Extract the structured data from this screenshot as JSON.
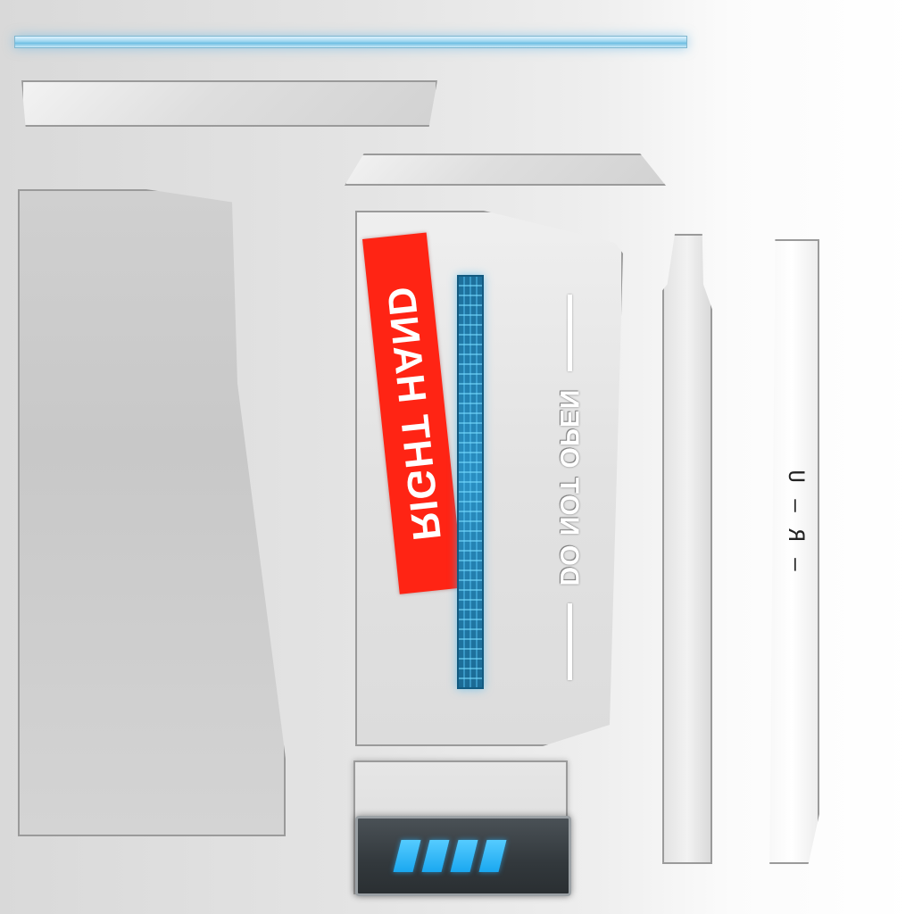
{
  "labels": {
    "right_hand": "RIGHT HAND",
    "warning": "DO NOT OPEN",
    "code": "— R — U"
  },
  "colors": {
    "label_red": "#ff2414",
    "accent_blue": "#1aa8f0",
    "panel_grey": "#dcdcdc",
    "battery_dark": "#32383c"
  },
  "battery": {
    "cells_filled": 4,
    "cells_total": 4
  },
  "icons": [
    "circuit-strip",
    "battery-indicator"
  ]
}
